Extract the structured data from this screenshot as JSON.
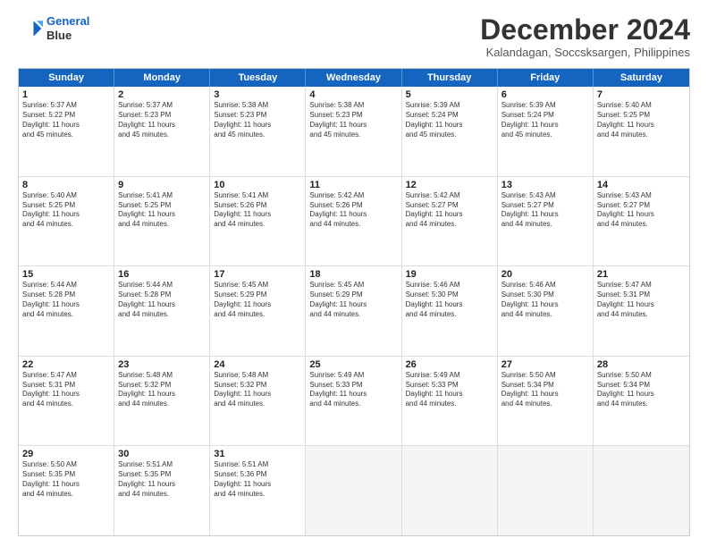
{
  "logo": {
    "line1": "General",
    "line2": "Blue"
  },
  "title": "December 2024",
  "subtitle": "Kalandagan, Soccsksargen, Philippines",
  "header_days": [
    "Sunday",
    "Monday",
    "Tuesday",
    "Wednesday",
    "Thursday",
    "Friday",
    "Saturday"
  ],
  "rows": [
    [
      {
        "day": "1",
        "text": "Sunrise: 5:37 AM\nSunset: 5:22 PM\nDaylight: 11 hours\nand 45 minutes."
      },
      {
        "day": "2",
        "text": "Sunrise: 5:37 AM\nSunset: 5:23 PM\nDaylight: 11 hours\nand 45 minutes."
      },
      {
        "day": "3",
        "text": "Sunrise: 5:38 AM\nSunset: 5:23 PM\nDaylight: 11 hours\nand 45 minutes."
      },
      {
        "day": "4",
        "text": "Sunrise: 5:38 AM\nSunset: 5:23 PM\nDaylight: 11 hours\nand 45 minutes."
      },
      {
        "day": "5",
        "text": "Sunrise: 5:39 AM\nSunset: 5:24 PM\nDaylight: 11 hours\nand 45 minutes."
      },
      {
        "day": "6",
        "text": "Sunrise: 5:39 AM\nSunset: 5:24 PM\nDaylight: 11 hours\nand 45 minutes."
      },
      {
        "day": "7",
        "text": "Sunrise: 5:40 AM\nSunset: 5:25 PM\nDaylight: 11 hours\nand 44 minutes."
      }
    ],
    [
      {
        "day": "8",
        "text": "Sunrise: 5:40 AM\nSunset: 5:25 PM\nDaylight: 11 hours\nand 44 minutes."
      },
      {
        "day": "9",
        "text": "Sunrise: 5:41 AM\nSunset: 5:25 PM\nDaylight: 11 hours\nand 44 minutes."
      },
      {
        "day": "10",
        "text": "Sunrise: 5:41 AM\nSunset: 5:26 PM\nDaylight: 11 hours\nand 44 minutes."
      },
      {
        "day": "11",
        "text": "Sunrise: 5:42 AM\nSunset: 5:26 PM\nDaylight: 11 hours\nand 44 minutes."
      },
      {
        "day": "12",
        "text": "Sunrise: 5:42 AM\nSunset: 5:27 PM\nDaylight: 11 hours\nand 44 minutes."
      },
      {
        "day": "13",
        "text": "Sunrise: 5:43 AM\nSunset: 5:27 PM\nDaylight: 11 hours\nand 44 minutes."
      },
      {
        "day": "14",
        "text": "Sunrise: 5:43 AM\nSunset: 5:27 PM\nDaylight: 11 hours\nand 44 minutes."
      }
    ],
    [
      {
        "day": "15",
        "text": "Sunrise: 5:44 AM\nSunset: 5:28 PM\nDaylight: 11 hours\nand 44 minutes."
      },
      {
        "day": "16",
        "text": "Sunrise: 5:44 AM\nSunset: 5:28 PM\nDaylight: 11 hours\nand 44 minutes."
      },
      {
        "day": "17",
        "text": "Sunrise: 5:45 AM\nSunset: 5:29 PM\nDaylight: 11 hours\nand 44 minutes."
      },
      {
        "day": "18",
        "text": "Sunrise: 5:45 AM\nSunset: 5:29 PM\nDaylight: 11 hours\nand 44 minutes."
      },
      {
        "day": "19",
        "text": "Sunrise: 5:46 AM\nSunset: 5:30 PM\nDaylight: 11 hours\nand 44 minutes."
      },
      {
        "day": "20",
        "text": "Sunrise: 5:46 AM\nSunset: 5:30 PM\nDaylight: 11 hours\nand 44 minutes."
      },
      {
        "day": "21",
        "text": "Sunrise: 5:47 AM\nSunset: 5:31 PM\nDaylight: 11 hours\nand 44 minutes."
      }
    ],
    [
      {
        "day": "22",
        "text": "Sunrise: 5:47 AM\nSunset: 5:31 PM\nDaylight: 11 hours\nand 44 minutes."
      },
      {
        "day": "23",
        "text": "Sunrise: 5:48 AM\nSunset: 5:32 PM\nDaylight: 11 hours\nand 44 minutes."
      },
      {
        "day": "24",
        "text": "Sunrise: 5:48 AM\nSunset: 5:32 PM\nDaylight: 11 hours\nand 44 minutes."
      },
      {
        "day": "25",
        "text": "Sunrise: 5:49 AM\nSunset: 5:33 PM\nDaylight: 11 hours\nand 44 minutes."
      },
      {
        "day": "26",
        "text": "Sunrise: 5:49 AM\nSunset: 5:33 PM\nDaylight: 11 hours\nand 44 minutes."
      },
      {
        "day": "27",
        "text": "Sunrise: 5:50 AM\nSunset: 5:34 PM\nDaylight: 11 hours\nand 44 minutes."
      },
      {
        "day": "28",
        "text": "Sunrise: 5:50 AM\nSunset: 5:34 PM\nDaylight: 11 hours\nand 44 minutes."
      }
    ],
    [
      {
        "day": "29",
        "text": "Sunrise: 5:50 AM\nSunset: 5:35 PM\nDaylight: 11 hours\nand 44 minutes."
      },
      {
        "day": "30",
        "text": "Sunrise: 5:51 AM\nSunset: 5:35 PM\nDaylight: 11 hours\nand 44 minutes."
      },
      {
        "day": "31",
        "text": "Sunrise: 5:51 AM\nSunset: 5:36 PM\nDaylight: 11 hours\nand 44 minutes."
      },
      {
        "day": "",
        "text": ""
      },
      {
        "day": "",
        "text": ""
      },
      {
        "day": "",
        "text": ""
      },
      {
        "day": "",
        "text": ""
      }
    ]
  ]
}
